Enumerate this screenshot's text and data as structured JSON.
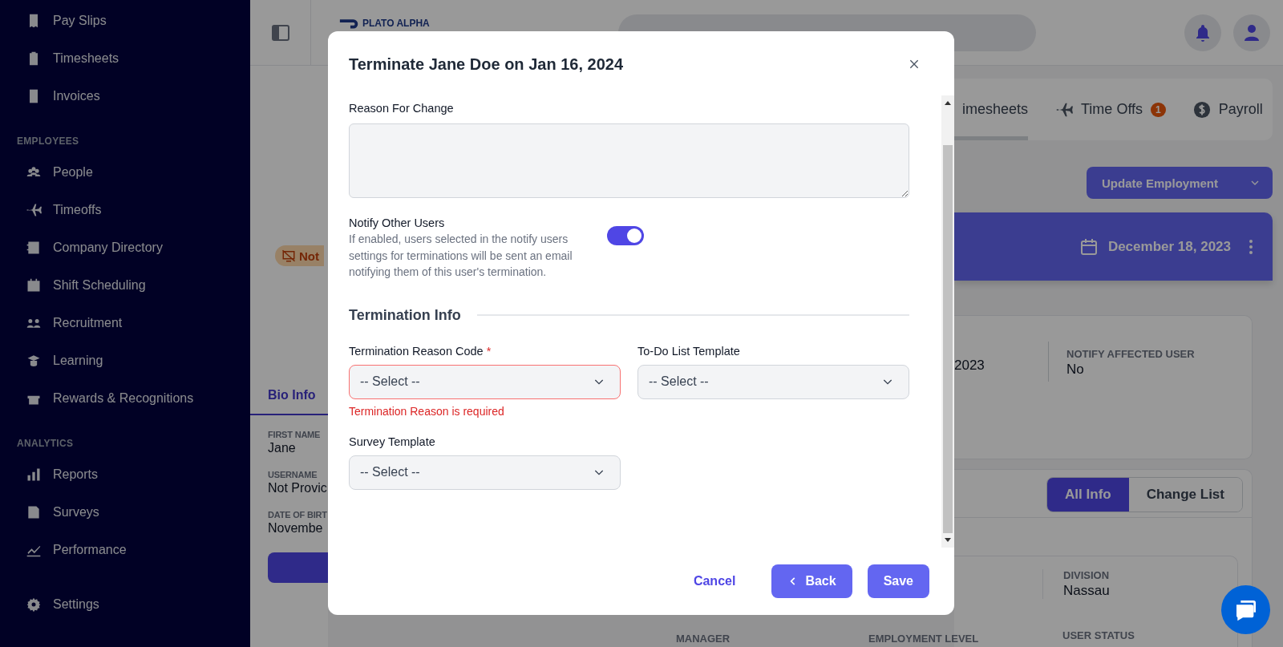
{
  "sidebar": {
    "items": [
      {
        "kind": "item",
        "label": "Pay Slips"
      },
      {
        "kind": "item",
        "label": "Timesheets"
      },
      {
        "kind": "item",
        "label": "Invoices"
      },
      {
        "kind": "heading",
        "label": "EMPLOYEES"
      },
      {
        "kind": "item",
        "label": "People"
      },
      {
        "kind": "item",
        "label": "Timeoffs"
      },
      {
        "kind": "item",
        "label": "Company Directory"
      },
      {
        "kind": "item",
        "label": "Shift Scheduling"
      },
      {
        "kind": "item",
        "label": "Recruitment"
      },
      {
        "kind": "item",
        "label": "Learning"
      },
      {
        "kind": "item",
        "label": "Rewards & Recognitions"
      },
      {
        "kind": "heading",
        "label": "ANALYTICS"
      },
      {
        "kind": "item",
        "label": "Reports"
      },
      {
        "kind": "item",
        "label": "Surveys"
      },
      {
        "kind": "item",
        "label": "Performance"
      }
    ],
    "footer_items": [
      {
        "label": "Settings"
      }
    ]
  },
  "header": {
    "logo": "PLATO ALPHA"
  },
  "profile": {
    "status_badge": "Not",
    "tab": "Bio Info",
    "fields": [
      {
        "label": "FIRST NAME",
        "value": "Jane"
      },
      {
        "label": "USERNAME",
        "value": "Not Provic"
      },
      {
        "label": "DATE OF BIRT",
        "value": "Novembe"
      }
    ]
  },
  "main": {
    "tabs": [
      {
        "label": "imesheets",
        "selected": true
      },
      {
        "label": "Time Offs",
        "badge": "1",
        "selected": false
      },
      {
        "label": "Payroll",
        "selected": false
      }
    ],
    "update_button": "Update Employment",
    "banner_date": "December 18, 2023",
    "summary": {
      "column_1_value": "2023",
      "notify_label": "NOTIFY AFFECTED USER",
      "notify_value": "No"
    },
    "view_toggle": [
      {
        "label": "All Info",
        "selected": true
      },
      {
        "label": "Change List",
        "selected": false
      }
    ],
    "details": [
      {
        "label": "DIVISION",
        "value": "Nassau"
      }
    ],
    "bottom_labels": [
      "MANAGER",
      "EMPLOYMENT LEVEL",
      "USER STATUS"
    ]
  },
  "modal": {
    "title": "Terminate Jane Doe on Jan 16, 2024",
    "reason_label": "Reason For Change",
    "notify": {
      "label": "Notify Other Users",
      "description": "If enabled, users selected in the notify users settings for terminations will be sent an email notifying them of this user's termination.",
      "on": true
    },
    "section_title": "Termination Info",
    "fields": [
      {
        "label": "Termination Reason Code",
        "required_mark": "*",
        "value": "-- Select --",
        "error": "Termination Reason is required"
      },
      {
        "label": "To-Do List Template",
        "value": "-- Select --"
      },
      {
        "label": "Survey Template",
        "value": "-- Select --"
      }
    ],
    "cancel": "Cancel",
    "back": "Back",
    "save": "Save"
  }
}
